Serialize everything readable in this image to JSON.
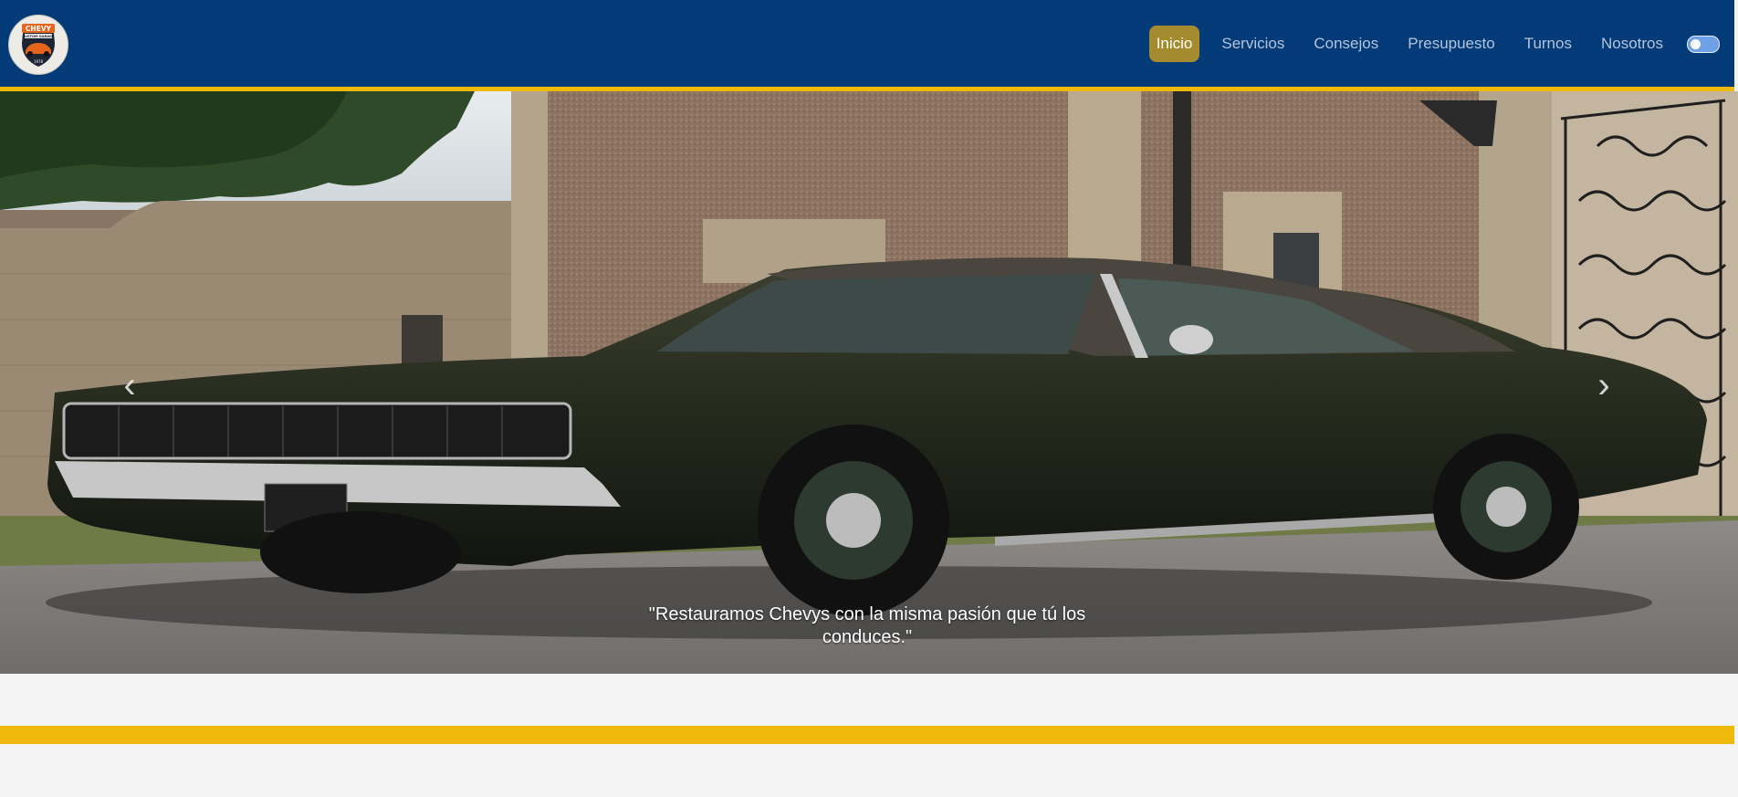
{
  "header": {
    "logo": {
      "icon": "chevy-garage-logo-icon",
      "brand_text": "CHEVY",
      "sub_text": "CUSTOM GARAGE",
      "year_text": "1978"
    },
    "nav": [
      {
        "label": "Inicio",
        "active": true
      },
      {
        "label": "Servicios",
        "active": false
      },
      {
        "label": "Consejos",
        "active": false
      },
      {
        "label": "Presupuesto",
        "active": false
      },
      {
        "label": "Turnos",
        "active": false
      },
      {
        "label": "Nosotros",
        "active": false
      }
    ],
    "theme_toggle": {
      "icon": "theme-toggle-icon",
      "on": false
    }
  },
  "hero": {
    "image_icon": "classic-car-photo",
    "caption": "\"Restauramos Chevys con la misma pasión que tú los conduces.\"",
    "prev_label": "‹",
    "next_label": "›"
  },
  "colors": {
    "navbar": "#033a78",
    "accent_yellow": "#f0b90b",
    "active_link": "#a38b2e",
    "page_bg": "#f4f4f4"
  }
}
